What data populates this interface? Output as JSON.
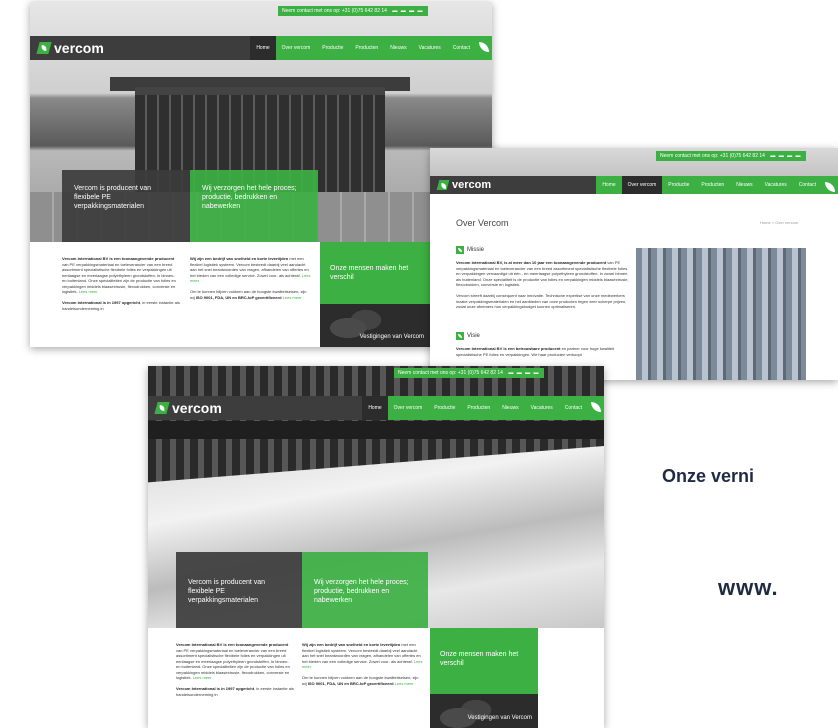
{
  "site": {
    "logo": "vercom",
    "contact": "Neem contact met ons op: +31 (0)75 642 82 14",
    "contact_short": "Neem contact met ons op: +31 (0)75 642 82 14",
    "flags": "▬ ▬ ▬ ▬",
    "menu": [
      "Home",
      "Over vercom",
      "Productie",
      "Producten",
      "Nieuws",
      "Vacatures",
      "Contact"
    ]
  },
  "home": {
    "banner_dark": "Vercom is producent van flexibele PE verpakkingsmaterialen",
    "banner_green": "Wij verzorgen het hele proces; productie, bedrukken en nabewerken",
    "col1": {
      "bold": "Vercom International BV is een toonaangevende producent",
      "text": " van PE verpakkingsmateriaal en toeleverancier van een breed assortiment specialistische flexibele folies en verpakkingen uit eenlaagse en meerlaagse polyethyleen grondstoffen, in binnen- en buitenland. Onze specialiteiten zijn de productie van folies en verpakkingen middels blaasextrusie, flexodrukken, conversie en logistiek.",
      "more": "Lees meer",
      "bold2": "Vercom International is in 1997 opgericht",
      "text2": ", in eerste instantie als handelsonderneming in"
    },
    "col2": {
      "bold": "Wij zijn een bedrijf van snelheid en korte levertijden",
      "text": " met een flexibel logistiek systeem. Vercom besteedt daarbij veel aandacht aan het snel beantwoorden van vragen, afhandelen van offertes en het bieden van een volledige service. Zowel voor- als achteraf.",
      "more": "Lees meer",
      "text2": "Om te kunnen blijven voldoen aan de hoogste kwaliteitseisen, zijn wij ",
      "bold2": "ISO 9001, FDA, UN en BRC-IoP gecertificeerd",
      "more2": "Lees meer"
    },
    "tile_green": "Onze mensen maken het verschil",
    "tile_map": "Vestigingen van Vercom"
  },
  "about": {
    "heading": "Over Vercom",
    "crumb": "Home > Over vercom",
    "mission_title": "Missie",
    "mission_bold": "Vercom International BV, is al meer dan 10 jaar een toonaangevende producent",
    "mission_text": " van PE verpakkingsmateriaal en toeleverancier van een breed assortiment specialistische flexibele folies en verpakkingen vervaardigd uit één - en meerlaagse polyethyleen grondstoffen. In zowel binnen als buitenland. Onze specialiteit is de productie van folies en verpakkingen middels blaasextrusie, flexodrukken, conversie en logistiek.",
    "mission_text2": "Vercom streeft daarbij consequent naar innovatie. Technische expertise van onze medewerkers inzake verpakkingsmaterialen en het aanbieden van onze producten tegen zeer scherpe prijzen, zodat onze afnemers hun verpakkingsbudget kunnen optimaliseren.",
    "vision_title": "Visie",
    "vision_bold": "Vercom International BV is een betrouwbare producent",
    "vision_text": " en partner voor hoge kwaliteit specialistische PE folies en verpakkingen. We haar producten verkoopt"
  },
  "promo": {
    "line1": "Onze verni",
    "line2": "www."
  },
  "colors": {
    "brand_green": "#3cb043",
    "dark": "#3d3d3d",
    "promo_text": "#1f2a44"
  }
}
